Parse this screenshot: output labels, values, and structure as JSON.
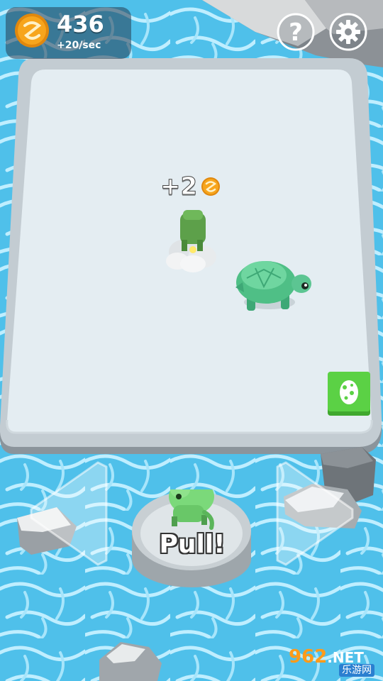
{
  "hud": {
    "coins": "436",
    "rate": "+20/sec",
    "help_symbol": "?"
  },
  "popup": {
    "reward": "+2"
  },
  "pull": {
    "label": "Pull!"
  },
  "watermark": {
    "main": "962",
    "suffix": ".NET",
    "sub": "乐游网"
  },
  "icons": {
    "coin": "coin-icon",
    "help": "question-mark-icon",
    "settings": "gear-icon",
    "egg": "egg-icon",
    "left": "left-arrow-icon",
    "right": "right-arrow-icon"
  },
  "colors": {
    "water": "#4fc0ea",
    "board": "#e4edf2",
    "coin": "#f7a51c",
    "egg_button": "#5bd145",
    "turtle": "#55c890",
    "dino": "#7bd97a"
  }
}
